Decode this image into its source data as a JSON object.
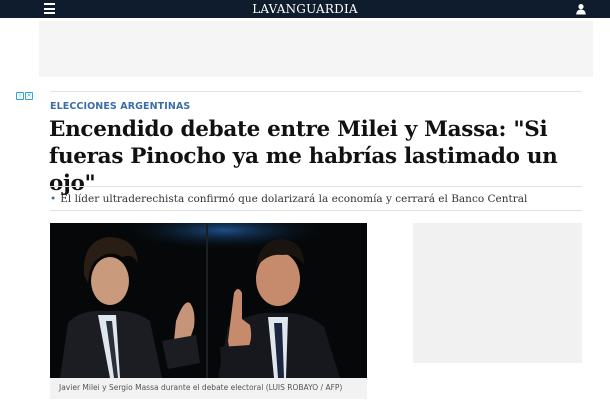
{
  "header": {
    "logo_text": "LAVANGUARDIA",
    "menu_icon": "hamburger-menu-icon",
    "user_icon": "user-icon",
    "background": "#0e1c2e"
  },
  "ads": {
    "adchoices_glyphs": [
      "i",
      "×"
    ]
  },
  "article": {
    "section": "ELECCIONES ARGENTINAS",
    "headline": "Encendido debate entre Milei y Massa: \"Si fueras Pinocho ya me habrías lastimado un ojo\"",
    "summary_bullet": "•",
    "summary": "El líder ultraderechista confirmó que dolarizará la economía y cerrará el Banco Central",
    "photo": {
      "caption": "Javier Milei y Sergio Massa durante el debate electoral  (LUIS ROBAYO / AFP)"
    }
  },
  "colors": {
    "accent": "#3b6ea8",
    "headline": "#111111",
    "rule": "#e2e2e2"
  }
}
